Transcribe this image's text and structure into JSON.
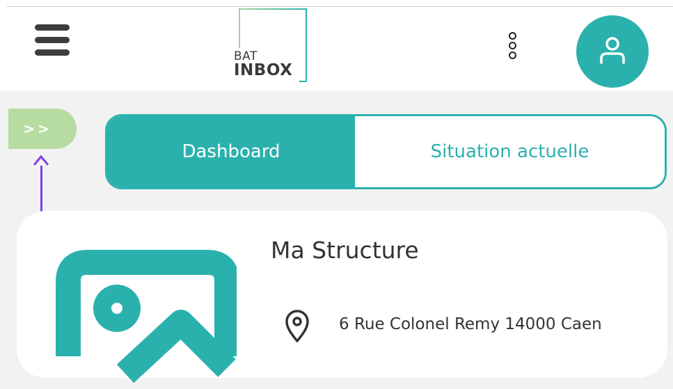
{
  "header": {
    "menu_icon": "hamburger-menu-icon",
    "logo": {
      "line1": "BAT",
      "line2": "INBOX"
    },
    "more_icon": "vertical-dots-icon",
    "profile_icon": "user-icon",
    "brand_color": "#2bb1ad"
  },
  "sidebar_toggle": {
    "label": ">>",
    "color": "#b7dca2"
  },
  "tabs": [
    {
      "label": "Dashboard",
      "active": true
    },
    {
      "label": "Situation actuelle",
      "active": false
    }
  ],
  "structure": {
    "title": "Ma Structure",
    "address_icon": "location-pin-icon",
    "address": "6 Rue Colonel Remy 14000 Caen",
    "image_icon": "image-placeholder-icon"
  }
}
